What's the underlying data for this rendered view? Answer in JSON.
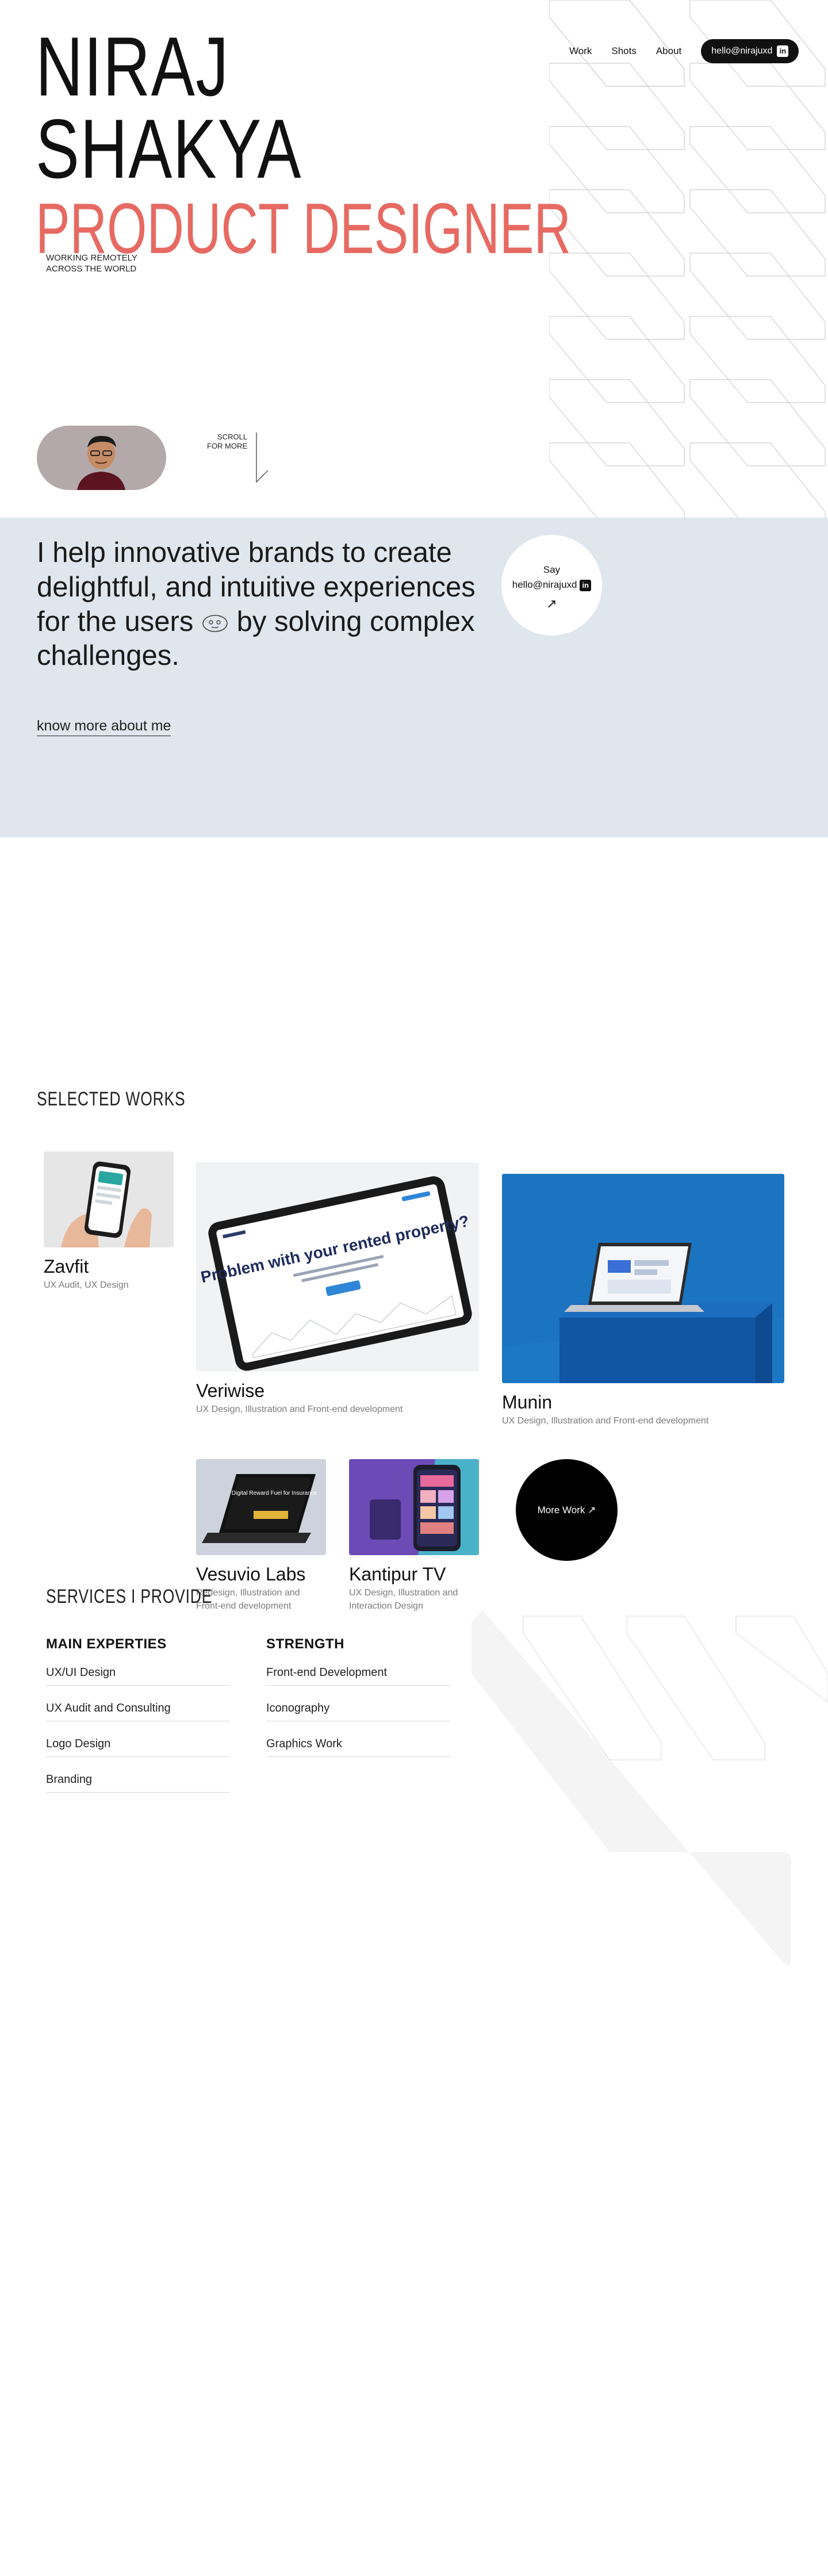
{
  "nav": {
    "links": [
      "Work",
      "Shots",
      "About"
    ],
    "email_pill": "hello@nirajuxd",
    "linkedin_label": "in"
  },
  "hero": {
    "first_name": "NIRAJ",
    "last_name": "SHAKYA",
    "role": "PRODUCT DESIGNER",
    "location_line1": "WORKING REMOTELY",
    "location_line2": "ACROSS THE WORLD",
    "scroll_line1": "SCROLL",
    "scroll_line2": "FOR MORE"
  },
  "intro": {
    "text_before_icon": "I help innovative brands to create delightful, and intuitive experiences for the users",
    "text_after_icon": " by solving complex challenges.",
    "know_more": "know more about me",
    "say_line1": "Say",
    "say_email": "hello@nirajuxd",
    "say_arrow": "↗"
  },
  "works": {
    "title": "SELECTED WORKS",
    "items": [
      {
        "title": "Zavfit",
        "desc": "UX Audit, UX Design"
      },
      {
        "title": "Veriwise",
        "desc": "UX Design, Illustration and Front-end development"
      },
      {
        "title": "Munin",
        "desc": "UX Design, Illustration and Front-end development"
      },
      {
        "title": "Vesuvio Labs",
        "desc": "Redesign, Illustration and Front-end development"
      },
      {
        "title": "Kantipur TV",
        "desc": "UX Design, Illustration and Interaction Design"
      }
    ],
    "veriwise_screen_headline": "Problem with your rented property?",
    "vesuvio_screen_headline": "Digital Reward Fuel for Insurance",
    "more_work": "More Work",
    "more_work_arrow": "↗"
  },
  "services": {
    "title": "SERVICES I PROVIDE",
    "main": {
      "heading": "MAIN EXPERTIES",
      "items": [
        "UX/UI Design",
        "UX Audit and Consulting",
        "Logo Design",
        "Branding"
      ]
    },
    "strength": {
      "heading": "STRENGTH",
      "items": [
        "Front-end Development",
        "Iconography",
        "Graphics Work"
      ]
    }
  },
  "colors": {
    "accent": "#e66a62",
    "intro_bg": "#dfe6ee",
    "dark": "#111111"
  }
}
